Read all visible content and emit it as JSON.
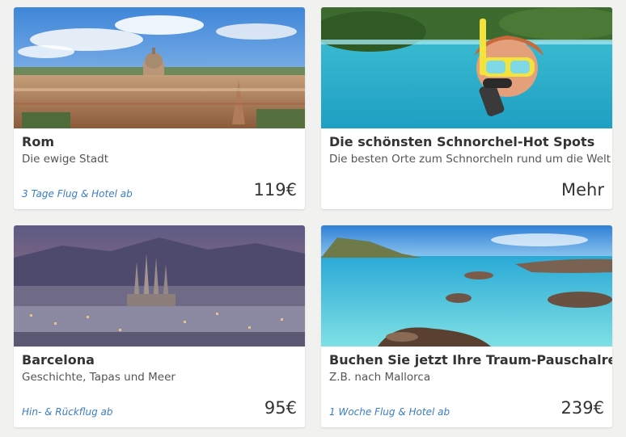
{
  "cards": [
    {
      "title": "Rom",
      "subtitle": "Die ewige Stadt",
      "note": "3 Tage Flug & Hotel ab",
      "price": "119€",
      "image": "rome-cityscape"
    },
    {
      "title": "Die schönsten Schnorchel-Hot Spots",
      "subtitle": "Die besten Orte zum Schnorcheln rund um die Welt",
      "note": "",
      "price": "Mehr",
      "image": "snorkeling-girl"
    },
    {
      "title": "Barcelona",
      "subtitle": "Geschichte, Tapas und Meer",
      "note": "Hin- & Rückflug ab",
      "price": "95€",
      "image": "barcelona-sagrada-familia"
    },
    {
      "title": "Buchen Sie jetzt Ihre Traum-Pauschalreise!",
      "subtitle": "Z.B. nach Mallorca",
      "note": "1 Woche Flug & Hotel ab",
      "price": "239€",
      "image": "mallorca-coast"
    }
  ],
  "colors": {
    "background": "#f1f1ef",
    "card": "#ffffff",
    "link_note": "#3b7dc6",
    "text": "#333333"
  }
}
